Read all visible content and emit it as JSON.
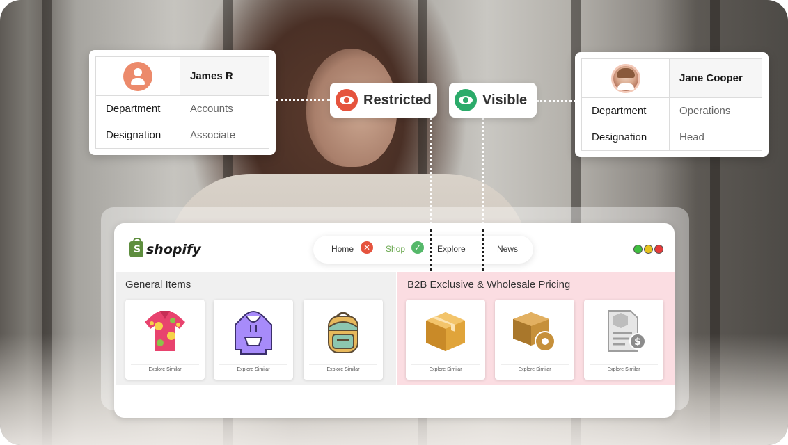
{
  "users": [
    {
      "name": "James R",
      "avatar": "generic-user-icon",
      "fields": [
        {
          "label": "Department",
          "value": "Accounts"
        },
        {
          "label": "Designation",
          "value": "Associate"
        }
      ]
    },
    {
      "name": "Jane Cooper",
      "avatar": "photo-avatar",
      "fields": [
        {
          "label": "Department",
          "value": "Operations"
        },
        {
          "label": "Designation",
          "value": "Head"
        }
      ]
    }
  ],
  "access": {
    "restricted_label": "Restricted",
    "visible_label": "Visible",
    "restricted_color": "#e5533d",
    "visible_color": "#2bab6a"
  },
  "store": {
    "brand": "shopify",
    "brand_color": "#5e8e3e",
    "nav": [
      {
        "label": "Home",
        "status": "restricted"
      },
      {
        "label": "Shop",
        "status": "visible"
      },
      {
        "label": "Explore"
      },
      {
        "label": "News"
      }
    ],
    "window_dots": [
      "#3fbf3f",
      "#e6c21e",
      "#e53b3b"
    ],
    "sections": [
      {
        "title": "General Items",
        "products": [
          {
            "icon": "shirt-icon",
            "action": "Explore Similar"
          },
          {
            "icon": "hoodie-icon",
            "action": "Explore Similar"
          },
          {
            "icon": "backpack-icon",
            "action": "Explore Similar"
          }
        ]
      },
      {
        "title": "B2B Exclusive & Wholesale Pricing",
        "products": [
          {
            "icon": "package-box-icon",
            "action": "Explore Similar"
          },
          {
            "icon": "box-gear-icon",
            "action": "Explore Similar"
          },
          {
            "icon": "invoice-icon",
            "action": "Explore Similar"
          }
        ]
      }
    ]
  }
}
